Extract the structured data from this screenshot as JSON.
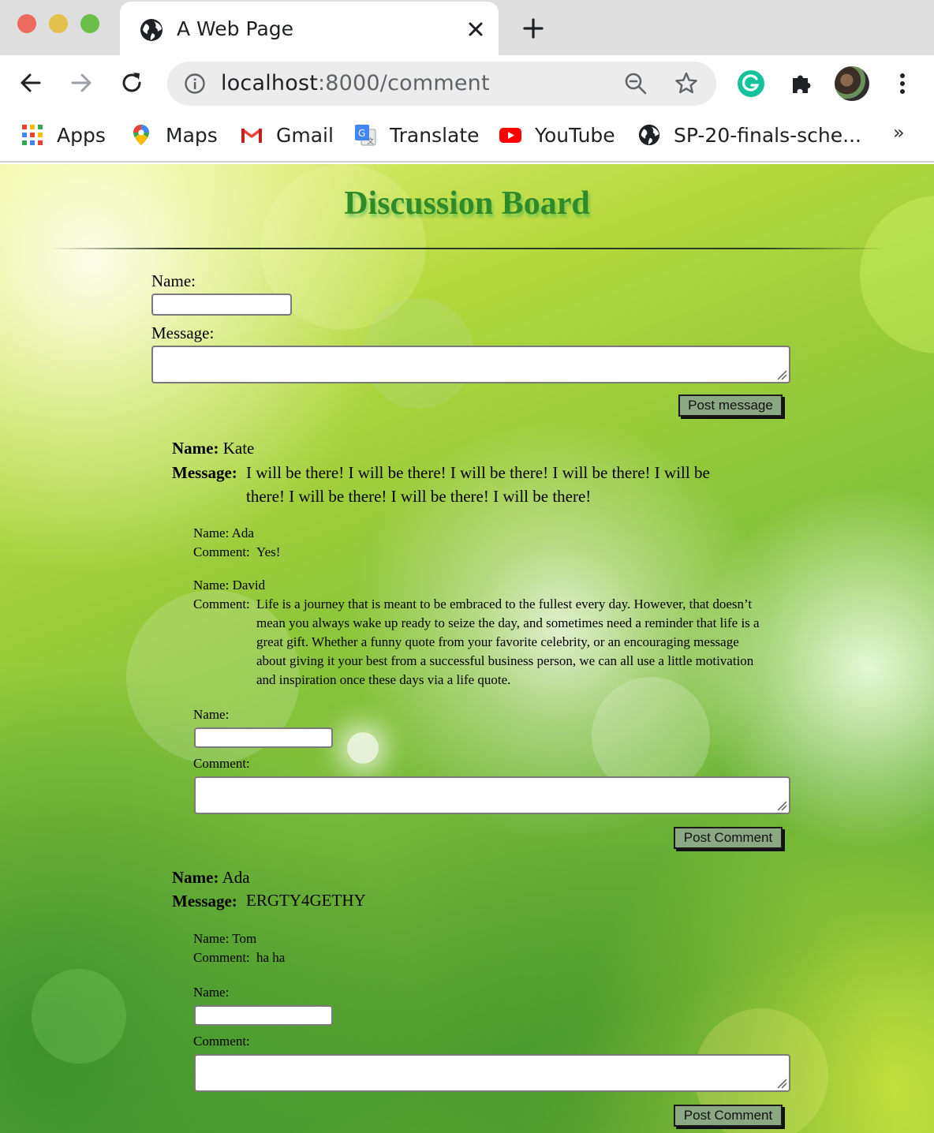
{
  "browser": {
    "tab_title": "A Web Page",
    "url_host": "localhost",
    "url_path": ":8000/comment",
    "bookmarks": [
      {
        "label": "Apps",
        "icon": "apps-grid-icon"
      },
      {
        "label": "Maps",
        "icon": "maps-pin-icon"
      },
      {
        "label": "Gmail",
        "icon": "gmail-icon"
      },
      {
        "label": "Translate",
        "icon": "translate-icon"
      },
      {
        "label": "YouTube",
        "icon": "youtube-icon"
      },
      {
        "label": "SP-20-finals-sche...",
        "icon": "globe-icon"
      }
    ],
    "bookmarks_overflow": "»"
  },
  "page": {
    "title": "Discussion Board",
    "form": {
      "name_label": "Name:",
      "message_label": "Message:",
      "name_value": "",
      "message_value": "",
      "submit_label": "Post message"
    },
    "posts": [
      {
        "name_label": "Name:",
        "name": "Kate",
        "message_label": "Message:",
        "message": "I will be there! I will be there! I will be there! I will be there! I will be there! I will be there! I will be there! I will be there!",
        "comments": [
          {
            "name_line": "Name: Ada",
            "comment_label": "Comment:",
            "comment": "Yes!"
          },
          {
            "name_line": "Name: David",
            "comment_label": "Comment:",
            "comment": "Life is a journey that is meant to be embraced to the fullest every day. However, that doesn’t mean you always wake up ready to seize the day, and sometimes need a reminder that life is a great gift. Whether a funny quote from your favorite celebrity, or an encouraging message about giving it your best from a successful business person, we can all use a little motivation and inspiration once these days via a life quote."
          }
        ],
        "comment_form": {
          "name_label": "Name:",
          "comment_label": "Comment:",
          "name_value": "",
          "comment_value": "",
          "submit_label": "Post Comment"
        }
      },
      {
        "name_label": "Name:",
        "name": "Ada",
        "message_label": "Message:",
        "message": "ERGTY4GETHY",
        "comments": [
          {
            "name_line": "Name: Tom",
            "comment_label": "Comment:",
            "comment": "ha ha"
          }
        ],
        "comment_form": {
          "name_label": "Name:",
          "comment_label": "Comment:",
          "name_value": "",
          "comment_value": "",
          "submit_label": "Post Comment"
        }
      }
    ]
  },
  "colors": {
    "title": "#2f8a2a",
    "button_bg": "#8aa882"
  }
}
